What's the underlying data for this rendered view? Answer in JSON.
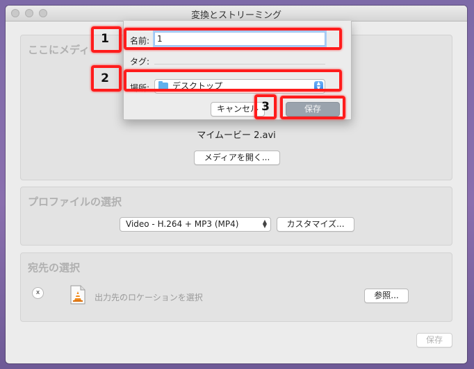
{
  "window": {
    "title": "変換とストリーミング"
  },
  "media_section": {
    "title": "ここにメディ",
    "filename": "マイムービー 2.avi",
    "open_media_button": "メディアを開く..."
  },
  "profile_section": {
    "title": "プロファイルの選択",
    "profile_selected": "Video - H.264 + MP3 (MP4)",
    "customize_button": "カスタマイズ..."
  },
  "destination_section": {
    "title": "宛先の選択",
    "close_symbol": "x",
    "location_placeholder": "出力先のロケーションを選択",
    "browse_button": "参照..."
  },
  "footer": {
    "save_button": "保存"
  },
  "save_sheet": {
    "name_label": "名前:",
    "name_value": "1",
    "tags_label": "タグ:",
    "location_label": "場所:",
    "location_value": "デスクトップ",
    "cancel_button": "キャンセル",
    "save_button": "保存"
  },
  "annotations": [
    {
      "number": "1"
    },
    {
      "number": "2"
    },
    {
      "number": "3"
    }
  ],
  "colors": {
    "annotation_red": "#ff1c1c",
    "focus_blue": "#a8cdf6",
    "primary_button": "#8aa9d6",
    "folder_blue": "#5fb0ec"
  },
  "icons": [
    "folder-icon",
    "up-down-arrows-icon",
    "vlc-cone-document-icon",
    "close-icon"
  ]
}
